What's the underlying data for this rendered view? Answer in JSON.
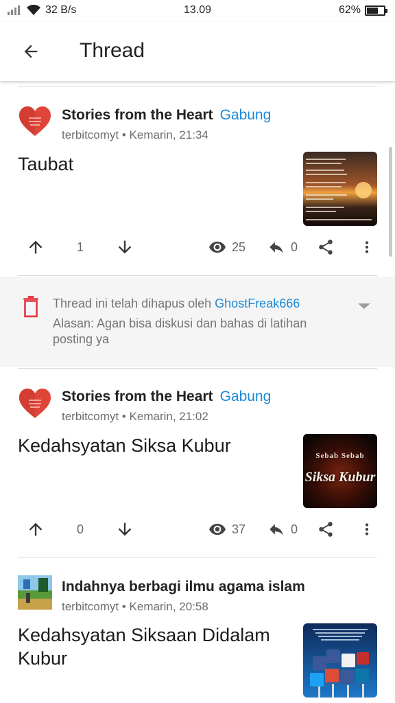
{
  "status_bar": {
    "speed": "32 B/s",
    "time": "13.09",
    "battery": "62%",
    "battery_level": 0.62
  },
  "header": {
    "title": "Thread"
  },
  "posts": [
    {
      "community": "Stories from the Heart",
      "join_label": "Gabung",
      "author": "terbitcomyt",
      "time": "Kemarin, 21:34",
      "title": "Taubat",
      "votes": "1",
      "views": "25",
      "replies": "0",
      "thumbnail_icon": "sunset-quote-image"
    },
    {
      "community": "Stories from the Heart",
      "join_label": "Gabung",
      "author": "terbitcomyt",
      "time": "Kemarin, 21:02",
      "title": "Kedahsyatan Siksa Kubur",
      "votes": "0",
      "views": "37",
      "replies": "0",
      "thumbnail_icon": "siksa-kubur-image",
      "thumbnail_text_top": "Sebab Sebab",
      "thumbnail_text_main": "Siksa Kubur"
    },
    {
      "community": "Indahnya berbagi ilmu agama islam",
      "author": "terbitcomyt",
      "time": "Kemarin, 20:58",
      "title": "Kedahsyatan Siksaan Didalam Kubur",
      "thumbnail_icon": "social-media-image"
    }
  ],
  "deleted_notice": {
    "prefix": "Thread ini telah dihapus oleh ",
    "moderator": "GhostFreak666",
    "reason": "Alasan: Agan bisa diskusi dan bahas di latihan posting ya"
  },
  "colors": {
    "accent": "#1a88d8",
    "heart": "#e0453a",
    "delete": "#e53945"
  }
}
